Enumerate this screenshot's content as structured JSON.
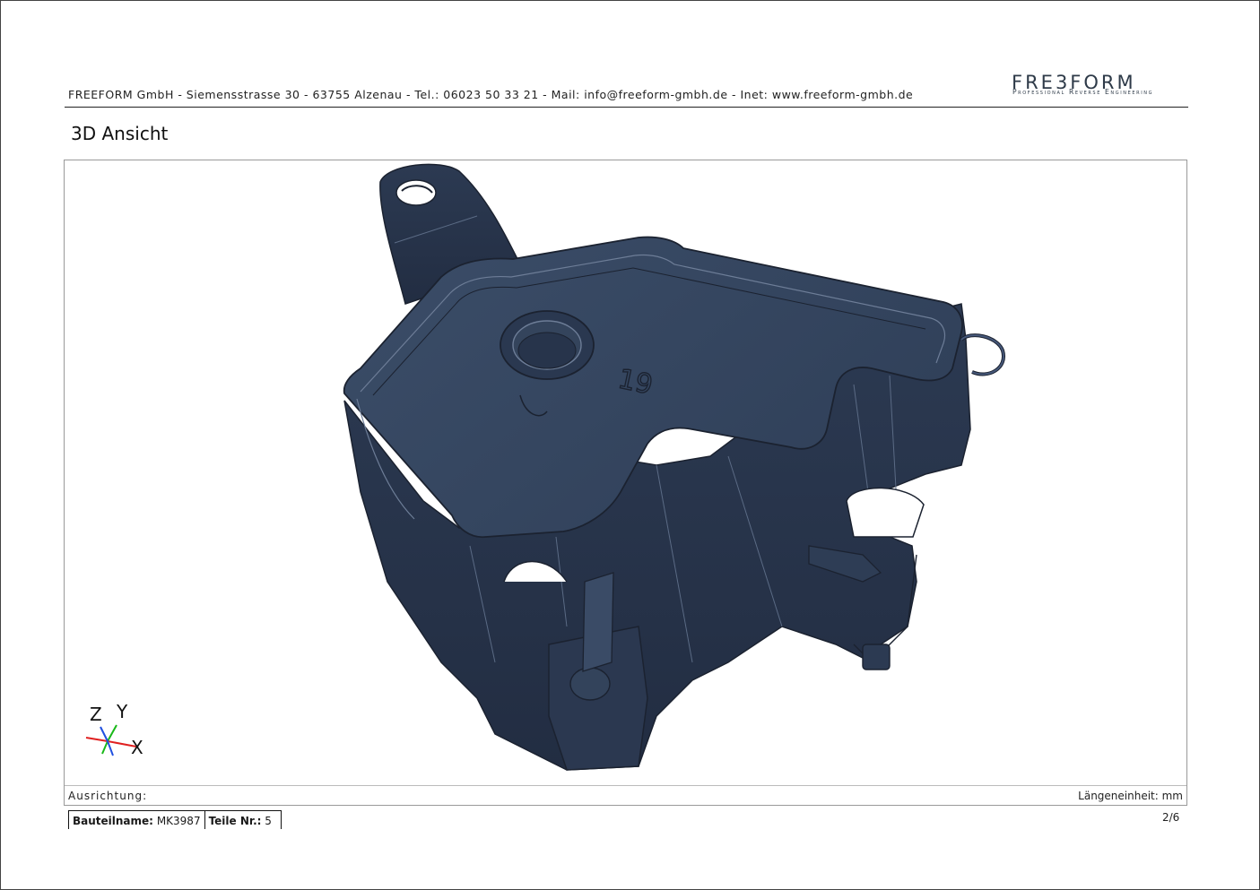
{
  "header": {
    "company_line": "FREEFORM GmbH - Siemensstrasse 30 - 63755 Alzenau - Tel.: 06023 50 33 21 - Mail: info@freeform-gmbh.de - Inet: www.freeform-gmbh.de",
    "logo_word": "FRE3FORM",
    "logo_tagline": "Professional Reverse Engineering"
  },
  "section": {
    "title": "3D Ansicht"
  },
  "viewer": {
    "part_marking": "19",
    "axes": {
      "z": "Z",
      "y": "Y",
      "x": "X"
    },
    "colors": {
      "model": "#34445c",
      "edge": "#1b2230",
      "highlight": "#6d7d97"
    }
  },
  "status": {
    "orientation_label": "Ausrichtung:",
    "unit_label": "Längeneinheit: mm"
  },
  "footer": {
    "part_name_label": "Bauteilname:",
    "part_name": "MK3987",
    "part_no_label": "Teile Nr.:",
    "part_no": "5",
    "page": "2/6"
  }
}
